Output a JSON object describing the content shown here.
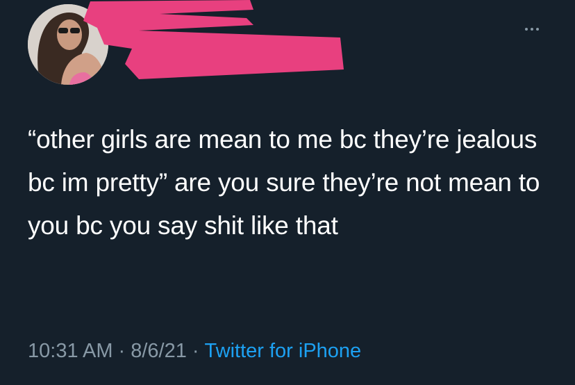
{
  "tweet": {
    "text": "“other girls are mean to me bc they’re jealous bc im pretty” are you sure they’re not mean to you bc you say shit like that",
    "time": "10:31 AM",
    "separator": "·",
    "date": "8/6/21",
    "source": "Twitter for iPhone"
  },
  "icons": {
    "more": "more-horizontal-icon",
    "avatar": "profile-photo"
  },
  "colors": {
    "background": "#15202b",
    "text": "#ffffff",
    "secondary_text": "#8899a6",
    "link": "#1da1f2",
    "redaction": "#e8407f"
  }
}
